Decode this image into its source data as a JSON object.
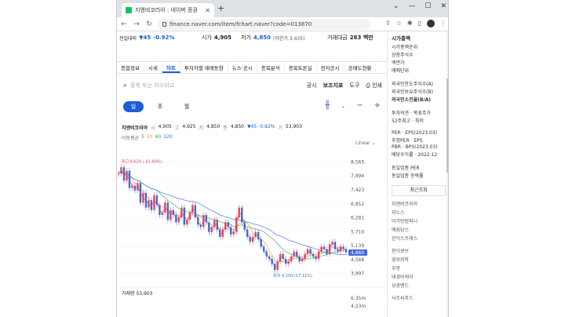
{
  "browser": {
    "tab_title": "지엔비코리아 : 네이버 증권",
    "url": "finance.naver.com/item/fchart.naver?code=013870"
  },
  "quote": {
    "prev_label": "전일대비",
    "change": "▼45",
    "change_pct": "-0.92%",
    "open_label": "시가",
    "open": "4,905",
    "low_label": "저가",
    "low": "4,850",
    "low_limit": "(하한가 3,435)",
    "amount_label": "거래대금",
    "amount": "263 백만"
  },
  "subnav": [
    "종합정보",
    "시세",
    "차트",
    "투자자별 매매동향",
    "뉴스·공시",
    "종목분석",
    "종목토론실",
    "전자공시",
    "공매도현황"
  ],
  "subnav_active": "차트",
  "search": {
    "placeholder": "종목 또는 지수비교"
  },
  "tools": [
    "공시",
    "보조지표",
    "도구",
    "인쇄"
  ],
  "periods": [
    "일",
    "주",
    "월"
  ],
  "period_active": "일",
  "info": {
    "name": "지엔비코리아",
    "open_k": "시",
    "open": "4,905",
    "high_k": "고",
    "high": "4,925",
    "low_k": "저",
    "low": "4,850",
    "close_k": "종",
    "close": "4,850",
    "chg": "▼45 -0.92%",
    "vol_k": "거",
    "vol": "53,903"
  },
  "ma": {
    "label": "이동평균",
    "periods": [
      "5",
      "20",
      "60",
      "120"
    ]
  },
  "scale_label": "Linear",
  "volume_label": "거래량 53,903",
  "right": {
    "cap_title": "시가총액",
    "cap_items": [
      "시가총액순위",
      "상장주식수",
      "액면가",
      "매매단위"
    ],
    "foreign_items": [
      "외국인한도주식수(A)",
      "외국인보유주식수(B)",
      "외국인소진율(B/A)"
    ],
    "opinion_items": [
      "투자의견 · 목표주가",
      "52주최고 · 최저"
    ],
    "per_items": [
      "PER · EPS(2023.03)",
      "추정PER · EPS",
      "PBR · BPS(2023.03)",
      "배당수익률 · 2022.12"
    ],
    "sector_items": [
      "동일업종 PER",
      "동일업종 등락률"
    ],
    "recent_title": "최근조회",
    "recent_items": [
      "지엔비코리아",
      "지누스",
      "아가방컴퍼니",
      "예림당스",
      "한익스프레스",
      "",
      "현익큐브",
      "영보화학",
      "부방",
      "태경비케이",
      "성광벤드",
      "",
      "사조씨푸드"
    ]
  },
  "chart_data": {
    "type": "line",
    "title": "",
    "ylabel": "",
    "y_ticks": [
      8565,
      7994,
      7423,
      6852,
      6281,
      5710,
      5139,
      4568,
      3997
    ],
    "ylim": [
      3700,
      8900
    ],
    "vol_ticks": [
      "6.35m",
      "4.23m"
    ],
    "current_price_label": "4,860",
    "current_price": 4860,
    "max_annotation": "최고 8,620 (-41.89%)",
    "max_value": 8620,
    "min_annotation": "최저 4,150 (17.11%)",
    "min_value": 4150,
    "close_series": [
      8080,
      8350,
      7800,
      8200,
      7500,
      7600,
      7400,
      7700,
      6900,
      7300,
      6700,
      7000,
      6600,
      7200,
      6800,
      6400,
      6500,
      6900,
      6200,
      6600,
      6400,
      6100,
      6300,
      6700,
      6000,
      6200,
      6500,
      6800,
      6300,
      6000,
      5900,
      6400,
      6100,
      5700,
      5900,
      6200,
      5800,
      5500,
      5800,
      6100,
      5900,
      5600,
      5700,
      6300,
      6700,
      6100,
      5800,
      5500,
      5300,
      5500,
      5700,
      5400,
      5100,
      4900,
      4700,
      4600,
      4400,
      4150,
      4500,
      4800,
      4600,
      4400,
      4500,
      4700,
      4900,
      4700,
      4500,
      4600,
      4800,
      5000,
      4800,
      4700,
      4600,
      4900,
      5100,
      5000,
      4800,
      5200,
      5300,
      5000,
      4900,
      5100,
      5000,
      4860
    ],
    "ma_series": [
      {
        "name": "5",
        "color": "#e8425d"
      },
      {
        "name": "20",
        "color": "#f0a030"
      },
      {
        "name": "60",
        "color": "#33a852"
      },
      {
        "name": "120",
        "color": "#3f6ad8"
      }
    ],
    "colors": {
      "up": "#e8425d",
      "down": "#3f6ad8"
    }
  }
}
